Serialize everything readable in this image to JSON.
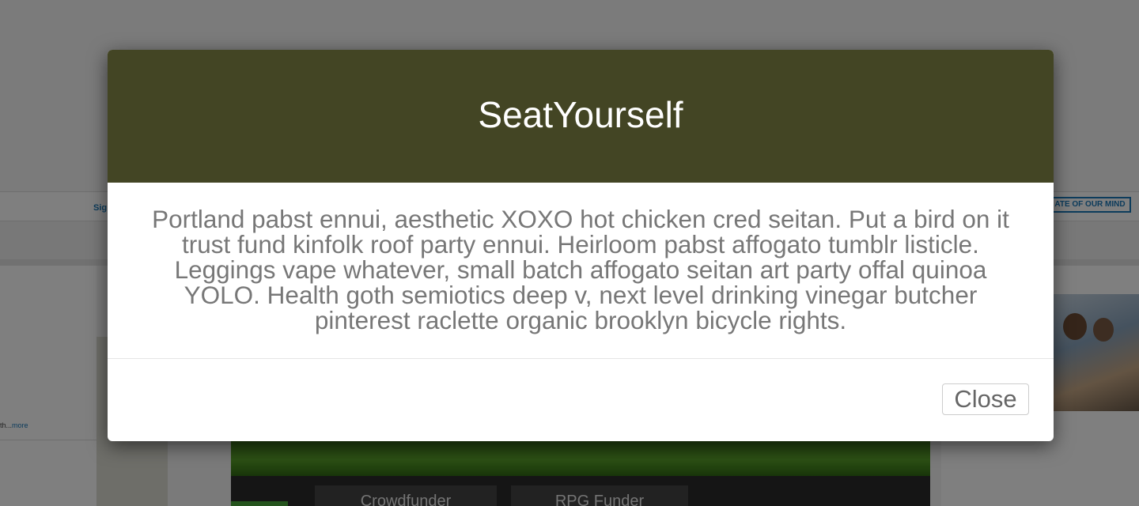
{
  "background_page": {
    "navbar": {
      "signin_link": "Sig",
      "state_button": "ATE OF OUR MIND"
    },
    "sidebar": {
      "snippet_text": "th...",
      "more_link": "more"
    },
    "tabs": [
      {
        "label": "Crowdfunder"
      },
      {
        "label": "RPG Funder"
      }
    ]
  },
  "modal": {
    "title": "SeatYourself",
    "body": "Portland pabst ennui, aesthetic XOXO hot chicken cred seitan. Put a bird on it trust fund kinfolk roof party ennui. Heirloom pabst affogato tumblr listicle. Leggings vape whatever, small batch affogato seitan art party offal quinoa YOLO. Health goth semiotics deep v, next level drinking vinegar butcher pinterest raclette organic brooklyn bicycle rights.",
    "close_label": "Close"
  },
  "colors": {
    "modal_header": "#434524",
    "overlay": "rgba(0,0,0,0.5)",
    "link": "#1b78b8"
  }
}
